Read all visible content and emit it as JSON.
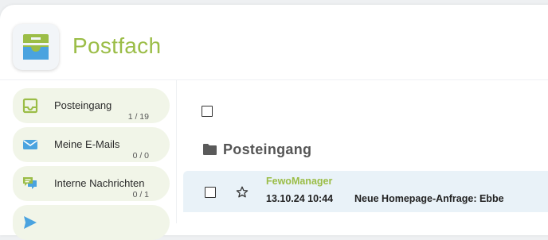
{
  "app": {
    "title": "Postfach"
  },
  "colors": {
    "brand_green": "#9bbd47",
    "accent_blue": "#4aa3df",
    "item_bg": "#f1f5e8",
    "row_bg": "#e9f2f8"
  },
  "sidebar": {
    "items": [
      {
        "label": "Posteingang",
        "count": "1 / 19",
        "icon": "inbox-icon"
      },
      {
        "label": "Meine E-Mails",
        "count": "0 / 0",
        "icon": "envelope-icon"
      },
      {
        "label": "Interne Nachrichten",
        "count": "0 / 1",
        "icon": "chat-icon"
      }
    ]
  },
  "main": {
    "folder": {
      "title": "Posteingang",
      "icon": "folder-icon"
    },
    "messages": [
      {
        "sender": "FewoManager",
        "date": "13.10.24 10:44",
        "subject": "Neue Homepage-Anfrage: Ebbe"
      }
    ]
  }
}
